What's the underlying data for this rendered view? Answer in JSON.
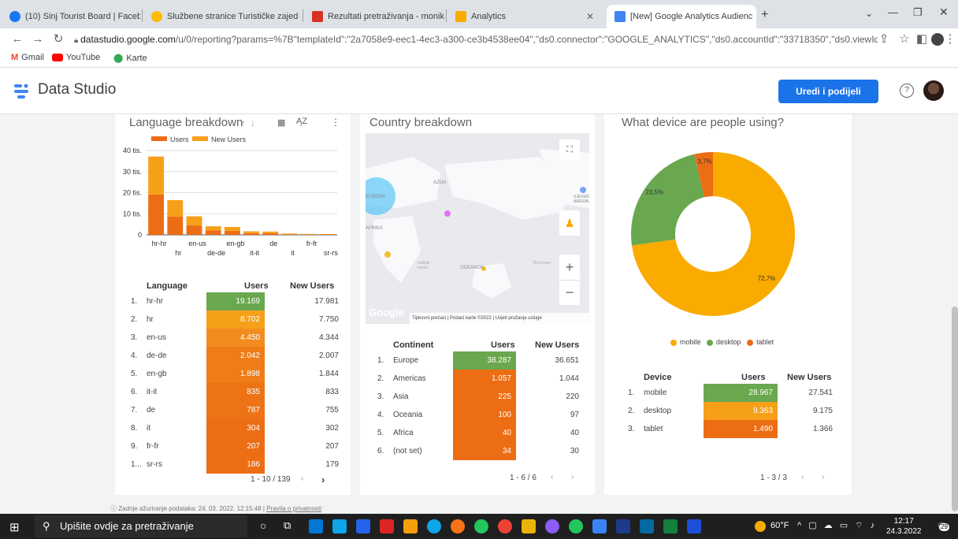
{
  "browser": {
    "tabs": [
      {
        "title": "(10) Sinj Tourist Board | Facebook",
        "icon_color": "#1877f2",
        "icon": "facebook-icon"
      },
      {
        "title": "Službene stranice Turističke zajed",
        "icon_color": "#fbbc04",
        "icon": "site-icon"
      },
      {
        "title": "Rezultati pretraživanja - monika",
        "icon_color": "#d93025",
        "icon": "gmail-icon"
      },
      {
        "title": "Analytics",
        "icon_color": "#f9ab00",
        "icon": "analytics-icon"
      },
      {
        "title": "[New] Google Analytics Audienc",
        "icon_color": "#4285f4",
        "icon": "data-studio-icon"
      }
    ],
    "url_host": "datastudio.google.com",
    "url_path": "/u/0/reporting?params=%7B\"templateId\":\"2a7058e9-eec1-4ec3-a300-ce3b4538ee04\",\"ds0.connector\":\"GOOGLE_ANALYTICS\",\"ds0.accountId\":\"33718350\",\"ds0.viewId\":\"6256...",
    "bookmarks": [
      {
        "label": "Gmail",
        "color": "#ea4335"
      },
      {
        "label": "YouTube",
        "color": "#ff0000"
      },
      {
        "label": "Karte",
        "color": "#34a853"
      }
    ]
  },
  "app": {
    "title": "Data Studio",
    "edit_button": "Uredi i podijeli",
    "footer_update": "Zadnje ažuriranje podataka: 24. 03. 2022. 12:15:48",
    "footer_link": "Pravila o privatnosti"
  },
  "language_card": {
    "title": "Language breakdown",
    "pager": "1 - 10 / 139",
    "table_headers": {
      "dimension": "Language",
      "users": "Users",
      "new_users": "New Users"
    },
    "rows": [
      {
        "idx": "1.",
        "name": "hr-hr",
        "users": "19.169",
        "new_users": "17.981",
        "users_val": 19169,
        "color": "#6aa84f"
      },
      {
        "idx": "2.",
        "name": "hr",
        "users": "8.702",
        "new_users": "7.750",
        "users_val": 8702,
        "color": "#f6a01a"
      },
      {
        "idx": "3.",
        "name": "en-us",
        "users": "4.450",
        "new_users": "4.344",
        "users_val": 4450,
        "color": "#f28c1e"
      },
      {
        "idx": "4.",
        "name": "de-de",
        "users": "2.042",
        "new_users": "2.007",
        "users_val": 2042,
        "color": "#f07c18"
      },
      {
        "idx": "5.",
        "name": "en-gb",
        "users": "1.898",
        "new_users": "1.844",
        "users_val": 1898,
        "color": "#f07c18"
      },
      {
        "idx": "6.",
        "name": "it-it",
        "users": "835",
        "new_users": "833",
        "users_val": 835,
        "color": "#ee7316"
      },
      {
        "idx": "7.",
        "name": "de",
        "users": "787",
        "new_users": "755",
        "users_val": 787,
        "color": "#ee7316"
      },
      {
        "idx": "8.",
        "name": "it",
        "users": "304",
        "new_users": "302",
        "users_val": 304,
        "color": "#ed6d14"
      },
      {
        "idx": "9.",
        "name": "fr-fr",
        "users": "207",
        "new_users": "207",
        "users_val": 207,
        "color": "#ed6d14"
      },
      {
        "idx": "1...",
        "name": "sr-rs",
        "users": "186",
        "new_users": "179",
        "users_val": 186,
        "color": "#ed6d14"
      }
    ]
  },
  "country_card": {
    "title": "Country breakdown",
    "map_labels": [
      "AZIJA",
      "EUROPA",
      "AFRIKA",
      "OCEANIJA",
      "SJEVERNA AMERIKA",
      "Indijski ocean",
      "Tihi ocean"
    ],
    "map_footer": [
      "Tipkovni prečaci",
      "Podaci karte ©2022",
      "Uvjeti pružanja usluge"
    ],
    "google_logo": "Google",
    "pager": "1 - 6 / 6",
    "table_headers": {
      "dimension": "Continent",
      "users": "Users",
      "new_users": "New Users"
    },
    "rows": [
      {
        "idx": "1.",
        "name": "Europe",
        "users": "38.287",
        "new_users": "36.651",
        "color": "#6aa84f"
      },
      {
        "idx": "2.",
        "name": "Americas",
        "users": "1.057",
        "new_users": "1.044",
        "color": "#ed6d14"
      },
      {
        "idx": "3.",
        "name": "Asia",
        "users": "225",
        "new_users": "220",
        "color": "#ed6d14"
      },
      {
        "idx": "4.",
        "name": "Oceania",
        "users": "100",
        "new_users": "97",
        "color": "#ed6d14"
      },
      {
        "idx": "5.",
        "name": "Africa",
        "users": "40",
        "new_users": "40",
        "color": "#ed6d14"
      },
      {
        "idx": "6.",
        "name": "(not set)",
        "users": "34",
        "new_users": "30",
        "color": "#ed6d14"
      }
    ]
  },
  "device_card": {
    "title": "What device are people using?",
    "pager": "1 - 3 / 3",
    "table_headers": {
      "dimension": "Device",
      "users": "Users",
      "new_users": "New Users"
    },
    "rows": [
      {
        "idx": "1.",
        "name": "mobile",
        "users": "28.967",
        "new_users": "27.541",
        "color": "#6aa84f"
      },
      {
        "idx": "2.",
        "name": "desktop",
        "users": "9.363",
        "new_users": "9.175",
        "color": "#f6a01a"
      },
      {
        "idx": "3.",
        "name": "tablet",
        "users": "1.490",
        "new_users": "1.366",
        "color": "#ed6d14"
      }
    ]
  },
  "chart_data": [
    {
      "type": "bar",
      "title": "Language breakdown",
      "categories": [
        "hr-hr",
        "hr",
        "en-us",
        "de-de",
        "en-gb",
        "it-it",
        "de",
        "it",
        "fr-fr",
        "sr-rs"
      ],
      "series": [
        {
          "name": "Users",
          "color": "#ed6d14",
          "values": [
            19169,
            8702,
            4450,
            2042,
            1898,
            835,
            787,
            304,
            207,
            186
          ]
        },
        {
          "name": "New Users",
          "color": "#f6a01a",
          "values": [
            17981,
            7750,
            4344,
            2007,
            1844,
            833,
            755,
            302,
            207,
            179
          ]
        }
      ],
      "stacked": true,
      "yticks": [
        "0",
        "10 tis.",
        "20 tis.",
        "30 tis.",
        "40 tis."
      ],
      "ylim": [
        0,
        40000
      ],
      "x_tick_labels_row1": [
        "hr-hr",
        "en-us",
        "en-gb",
        "de",
        "fr-fr"
      ],
      "x_tick_labels_row2": [
        "hr",
        "de-de",
        "it-it",
        "it",
        "sr-rs"
      ],
      "legend": "top"
    },
    {
      "type": "pie",
      "title": "What device are people using?",
      "donut": true,
      "slices": [
        {
          "name": "mobile",
          "value": 72.7,
          "label": "72,7%",
          "color": "#f9ab00"
        },
        {
          "name": "desktop",
          "value": 23.5,
          "label": "23,5%",
          "color": "#6aa84f"
        },
        {
          "name": "tablet",
          "value": 3.7,
          "label": "3,7%",
          "color": "#ed6d14"
        }
      ],
      "legend": "bottom"
    }
  ],
  "taskbar": {
    "search_placeholder": "Upišite ovdje za pretraživanje",
    "weather": "60°F",
    "time": "12:17",
    "date": "24.3.2022",
    "notif_count": "29"
  }
}
